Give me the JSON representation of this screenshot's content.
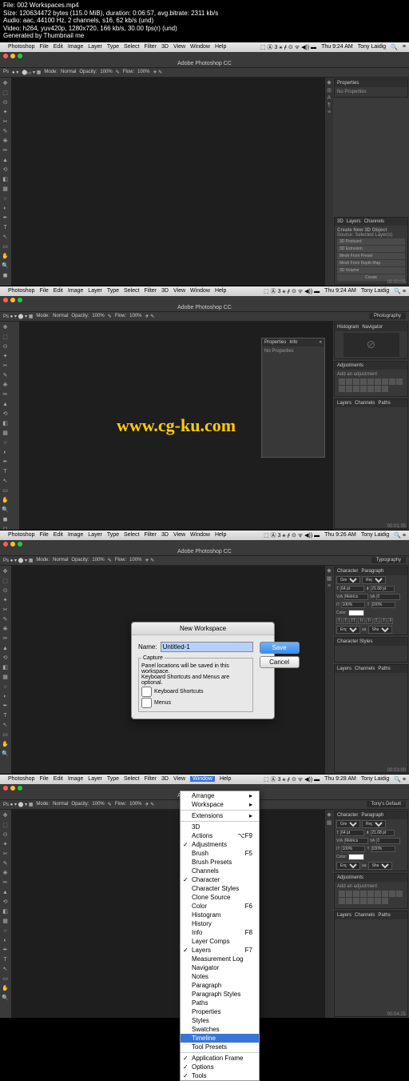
{
  "meta": {
    "file": "File: 002 Workspaces.mp4",
    "size": "Size: 120634472 bytes (115.0 MiB), duration: 0:06:57, avg.bitrate: 2311 kb/s",
    "audio": "Audio: aac, 44100 Hz, 2 channels, s16, 62 kb/s (und)",
    "video": "Video: h264, yuv420p, 1280x720, 166 kb/s, 30.00 fps(r) (und)",
    "gen": "Generated by Thumbnail me"
  },
  "app": {
    "title": "Adobe Photoshop CC",
    "menus": [
      "Photoshop",
      "File",
      "Edit",
      "Image",
      "Layer",
      "Type",
      "Select",
      "Filter",
      "3D",
      "View",
      "Window",
      "Help"
    ]
  },
  "sys": {
    "time1": "Thu 9:24 AM",
    "time2": "Thu 9:24 AM",
    "time3": "Thu 9:26 AM",
    "time4": "Thu 9:28 AM",
    "user": "Tony Laidig"
  },
  "optbar": {
    "mode": "Mode:",
    "modev": "Normal",
    "opacity": "Opacity:",
    "opv": "100%",
    "flow": "Flow:",
    "flv": "100%"
  },
  "ws": {
    "photography": "Photography",
    "typography": "Typography",
    "custom": "Tony's Default"
  },
  "watermark": "www.cg-ku.com",
  "props": {
    "tab1": "Properties",
    "tab2": "Info",
    "none": "No Properties"
  },
  "layers": {
    "tab": "Layers",
    "tab2": "Channels",
    "tab3": "Paths",
    "create3d": "Create New 3D Object",
    "source": "Source:",
    "srcv": "Selected Layer(s)",
    "o1": "3D Postcard",
    "o2": "3D Extrusion",
    "o3": "Mesh From Preset",
    "o4": "Mesh From Depth Map",
    "o5": "3D Volume",
    "create": "Create"
  },
  "histo": {
    "tab": "Histogram",
    "tab2": "Navigator"
  },
  "adjust": {
    "tab": "Adjustments",
    "add": "Add an adjustment"
  },
  "char": {
    "tab1": "Character",
    "tab2": "Paragraph",
    "font": "Great Vibes",
    "style": "Regular",
    "size": "64 pt",
    "lead": "21.68 pt",
    "va": "0",
    "metrics": "Metrics",
    "color": "Color:",
    "scale": "100%",
    "lang": "English: USA",
    "aa": "Sharp",
    "styles": "Character Styles",
    "pstyles": "Paragraph Styles"
  },
  "dialog": {
    "title": "New Workspace",
    "name": "Name:",
    "namev": "Untitled-1",
    "save": "Save",
    "cancel": "Cancel",
    "capture": "Capture",
    "desc": "Panel locations will be saved in this workspace.",
    "desc2": "Keyboard Shortcuts and Menus are optional.",
    "kb": "Keyboard Shortcuts",
    "menus": "Menus"
  },
  "winmenu": {
    "items": [
      {
        "l": "Arrange",
        "sub": true
      },
      {
        "l": "Workspace",
        "sub": true
      },
      {
        "sep": true
      },
      {
        "l": "Extensions",
        "sub": true
      },
      {
        "sep": true
      },
      {
        "l": "3D"
      },
      {
        "l": "Actions",
        "k": "⌥F9"
      },
      {
        "l": "Adjustments",
        "chk": true
      },
      {
        "l": "Brush",
        "k": "F5"
      },
      {
        "l": "Brush Presets"
      },
      {
        "l": "Channels"
      },
      {
        "l": "Character",
        "chk": true
      },
      {
        "l": "Character Styles"
      },
      {
        "l": "Clone Source"
      },
      {
        "l": "Color",
        "k": "F6"
      },
      {
        "l": "Histogram"
      },
      {
        "l": "History"
      },
      {
        "l": "Info",
        "k": "F8"
      },
      {
        "l": "Layer Comps"
      },
      {
        "l": "Layers",
        "chk": true,
        "k": "F7"
      },
      {
        "l": "Measurement Log"
      },
      {
        "l": "Navigator"
      },
      {
        "l": "Notes"
      },
      {
        "l": "Paragraph"
      },
      {
        "l": "Paragraph Styles"
      },
      {
        "l": "Paths"
      },
      {
        "l": "Properties"
      },
      {
        "l": "Styles"
      },
      {
        "l": "Swatches"
      },
      {
        "l": "Timeline",
        "hl": true
      },
      {
        "l": "Tool Presets"
      },
      {
        "sep": true
      },
      {
        "l": "Application Frame",
        "chk": true
      },
      {
        "l": "Options",
        "chk": true
      },
      {
        "l": "Tools",
        "chk": true
      }
    ]
  },
  "ts": {
    "t1": "00:00:05",
    "t2": "00:01:35",
    "t3": "00:03:00",
    "t4": "00:04:25"
  }
}
